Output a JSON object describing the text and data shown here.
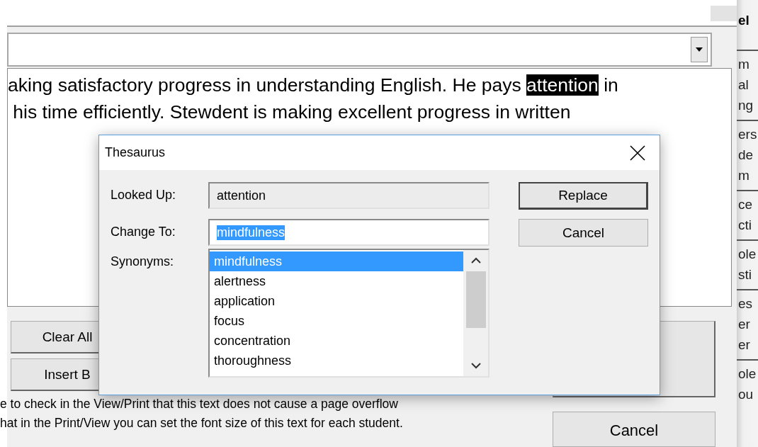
{
  "background_window": {
    "corner_label": "el",
    "text_lines": [
      {
        "segments": [
          {
            "text": "aking satisfactory progress in understanding English. He pays ",
            "highlighted": false
          },
          {
            "text": "attention",
            "highlighted": true
          },
          {
            "text": " in",
            "highlighted": false
          }
        ]
      },
      {
        "segments": [
          {
            "text": " his time efficiently. Stewdent is making excellent progress in written",
            "highlighted": false
          }
        ]
      }
    ],
    "buttons": [
      "Clear All",
      "Insert B"
    ],
    "notes": [
      "e to check in the View/Print that this text does not cause a page overflow",
      "hat in the Print/View you can set the font size of this text for each student."
    ],
    "cancel_button": "Cancel",
    "side_groups": [
      [
        "m",
        "al",
        "ng"
      ],
      [
        "ers",
        "de",
        "m"
      ],
      [
        "ce",
        "cti"
      ],
      [
        "ole",
        "sti"
      ],
      [
        "es",
        "er",
        "er"
      ],
      [
        "ole",
        "ou"
      ]
    ]
  },
  "dialog": {
    "title": "Thesaurus",
    "looked_up": {
      "label": "Looked Up:",
      "value": "attention"
    },
    "change_to": {
      "label": "Change To:",
      "value": "mindfulness",
      "selected": true
    },
    "synonyms": {
      "label": "Synonyms:",
      "items": [
        {
          "text": "mindfulness",
          "selected": true
        },
        {
          "text": "alertness",
          "selected": false
        },
        {
          "text": "application",
          "selected": false
        },
        {
          "text": "focus",
          "selected": false
        },
        {
          "text": "concentration",
          "selected": false
        },
        {
          "text": "thoroughness",
          "selected": false
        }
      ]
    },
    "buttons": [
      {
        "label": "Replace",
        "default": true
      },
      {
        "label": "Cancel",
        "default": false
      }
    ]
  }
}
